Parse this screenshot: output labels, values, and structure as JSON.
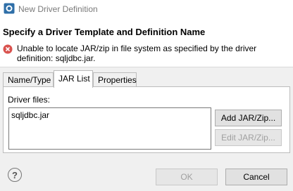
{
  "window": {
    "title": "New Driver Definition"
  },
  "header": {
    "title": "Specify a Driver Template and Definition Name",
    "error_message": "Unable to locate JAR/zip in file system as specified by the driver definition: sqljdbc.jar."
  },
  "tabs": [
    {
      "label": "Name/Type",
      "active": false
    },
    {
      "label": "JAR List",
      "active": true
    },
    {
      "label": "Properties",
      "active": false
    }
  ],
  "jar_list": {
    "driver_files_label": "Driver files:",
    "files": [
      "sqljdbc.jar"
    ],
    "add_button": "Add JAR/Zip...",
    "edit_button": "Edit JAR/Zip..."
  },
  "footer": {
    "help_label": "?",
    "ok_button": "OK",
    "cancel_button": "Cancel"
  },
  "colors": {
    "error_red": "#d9534f",
    "app_icon_blue": "#2f6fa8",
    "disabled_text": "#a0a0a0"
  },
  "icons": {
    "app": "database-driver-icon",
    "error": "error-icon",
    "help": "help-icon"
  }
}
